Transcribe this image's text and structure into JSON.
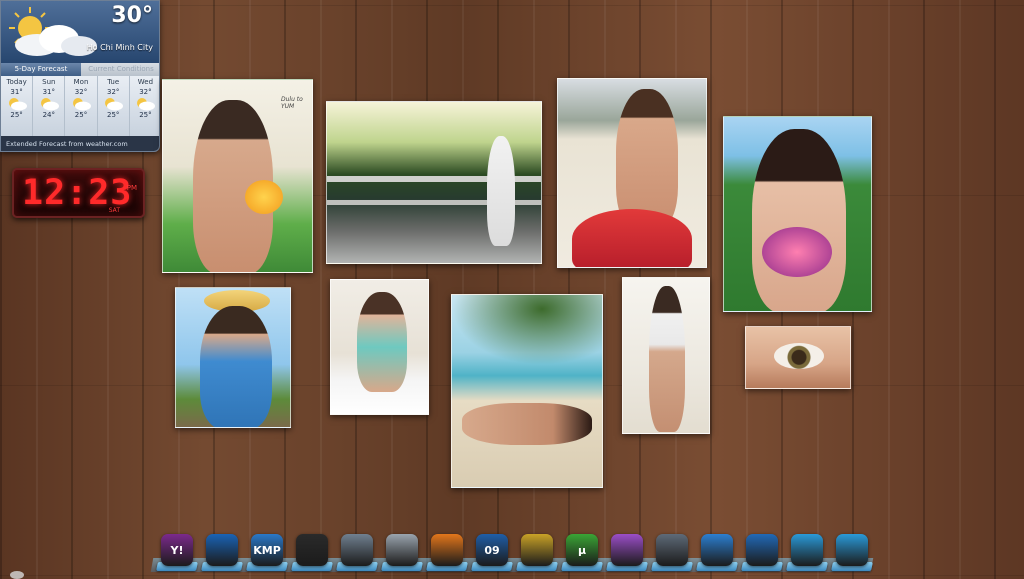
{
  "weather": {
    "temperature": "30°",
    "city": "Ho Chi Minh City",
    "tabs": [
      "5-Day Forecast",
      "Current Conditions"
    ],
    "active_tab": "5-Day Forecast",
    "forecast": [
      {
        "day": "Today",
        "high": "31°",
        "low": "25°",
        "icon": "partly-cloudy-icon"
      },
      {
        "day": "Sun",
        "high": "31°",
        "low": "24°",
        "icon": "partly-cloudy-icon"
      },
      {
        "day": "Mon",
        "high": "32°",
        "low": "25°",
        "icon": "partly-cloudy-icon"
      },
      {
        "day": "Tue",
        "high": "32°",
        "low": "25°",
        "icon": "partly-cloudy-icon"
      },
      {
        "day": "Wed",
        "high": "32°",
        "low": "25°",
        "icon": "partly-cloudy-icon"
      }
    ],
    "footer": "Extended Forecast from weather.com"
  },
  "clock": {
    "time": "12:23",
    "period": "PM",
    "day": "SAT"
  },
  "colors": {
    "clock_red": "#ff2a2a",
    "weather_blue": "#3f5e86",
    "dock_blue": "#3c88bd"
  },
  "photos": [
    {
      "name": "photo-girl-with-drink",
      "caption": "Dulu to YUM"
    },
    {
      "name": "photo-girl-on-bridge"
    },
    {
      "name": "photo-girl-on-beach-red-skirt"
    },
    {
      "name": "photo-girl-with-lei"
    },
    {
      "name": "photo-girl-straw-hat"
    },
    {
      "name": "photo-girl-on-bed"
    },
    {
      "name": "photo-girl-under-palm"
    },
    {
      "name": "photo-girl-bathroom"
    },
    {
      "name": "photo-eye-closeup"
    }
  ],
  "dock": [
    {
      "name": "yahoo-messenger-icon",
      "label": "Y!",
      "color": "#7b2a8c"
    },
    {
      "name": "media-player-icon",
      "label": "",
      "color": "#1a63b5"
    },
    {
      "name": "kmplayer-icon",
      "label": "KMP",
      "color": "#2a78c8"
    },
    {
      "name": "foobar-fox-icon",
      "label": "",
      "color": "#2a2a2a"
    },
    {
      "name": "user-account-icon",
      "label": "",
      "color": "#708090"
    },
    {
      "name": "desktop-folder-icon",
      "label": "",
      "color": "#9aa4ae"
    },
    {
      "name": "firefox-icon",
      "label": "",
      "color": "#e3761b"
    },
    {
      "name": "office-2009-icon",
      "label": "09",
      "color": "#1f5ea8"
    },
    {
      "name": "aim-running-man-icon",
      "label": "",
      "color": "#c9a227"
    },
    {
      "name": "utorrent-icon",
      "label": "µ",
      "color": "#3aa535"
    },
    {
      "name": "yahoo-smiley-icon",
      "label": "",
      "color": "#9b4ec8"
    },
    {
      "name": "save-disk-icon",
      "label": "",
      "color": "#5e6a78"
    },
    {
      "name": "windows-live-icon",
      "label": "",
      "color": "#2c7fd1"
    },
    {
      "name": "windows-start-icon",
      "label": "",
      "color": "#2169b7"
    },
    {
      "name": "control-panel-icon",
      "label": "",
      "color": "#2a9ad8"
    },
    {
      "name": "no-entry-settings-icon",
      "label": "",
      "color": "#2a9ad8"
    }
  ]
}
